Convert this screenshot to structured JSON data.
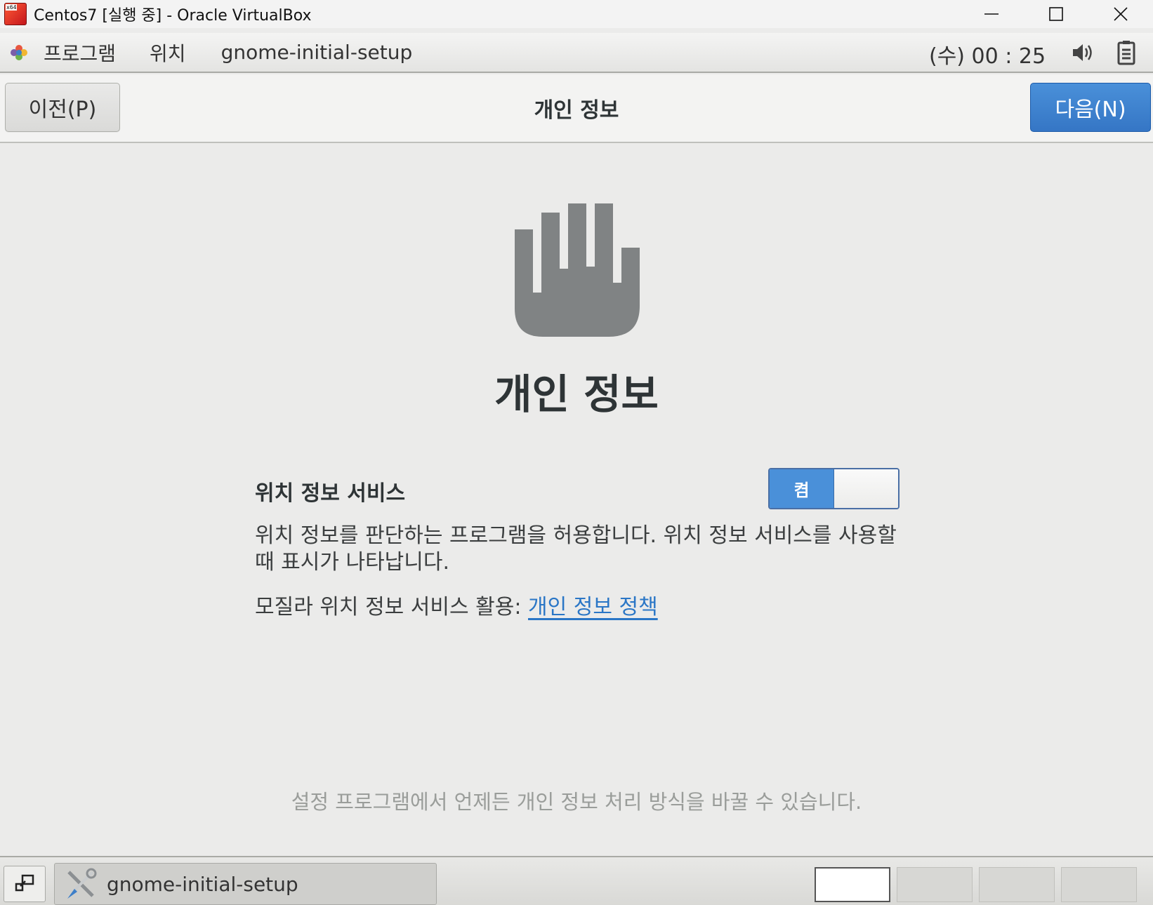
{
  "window": {
    "title": "Centos7 [실행 중] - Oracle VirtualBox",
    "logo_tag": "x64"
  },
  "topbar": {
    "menu_applications": "프로그램",
    "menu_places": "위치",
    "menu_app": "gnome-initial-setup",
    "clock": "(수) 00 : 25"
  },
  "header": {
    "prev_label": "이전(P)",
    "title": "개인 정보",
    "next_label": "다음(N)"
  },
  "main": {
    "heading": "개인 정보",
    "location_label": "위치 정보 서비스",
    "location_switch": {
      "state_label": "켬",
      "on": true
    },
    "description": "위치 정보를 판단하는 프로그램을 허용합니다. 위치 정보 서비스를 사용할 때 표시가 나타납니다.",
    "mozilla_prefix": "모질라 위치 정보 서비스 활용: ",
    "privacy_link": "개인 정보 정책",
    "footer_note": "설정 프로그램에서 언제든 개인 정보 처리 방식을 바꿀 수 있습니다."
  },
  "taskbar": {
    "task_label": "gnome-initial-setup",
    "workspaces": [
      {
        "active": true
      },
      {
        "active": false
      },
      {
        "active": false
      },
      {
        "active": false
      }
    ]
  },
  "colors": {
    "accent": "#4a90d9",
    "link": "#2a76c6",
    "icon_gray": "#808384"
  }
}
